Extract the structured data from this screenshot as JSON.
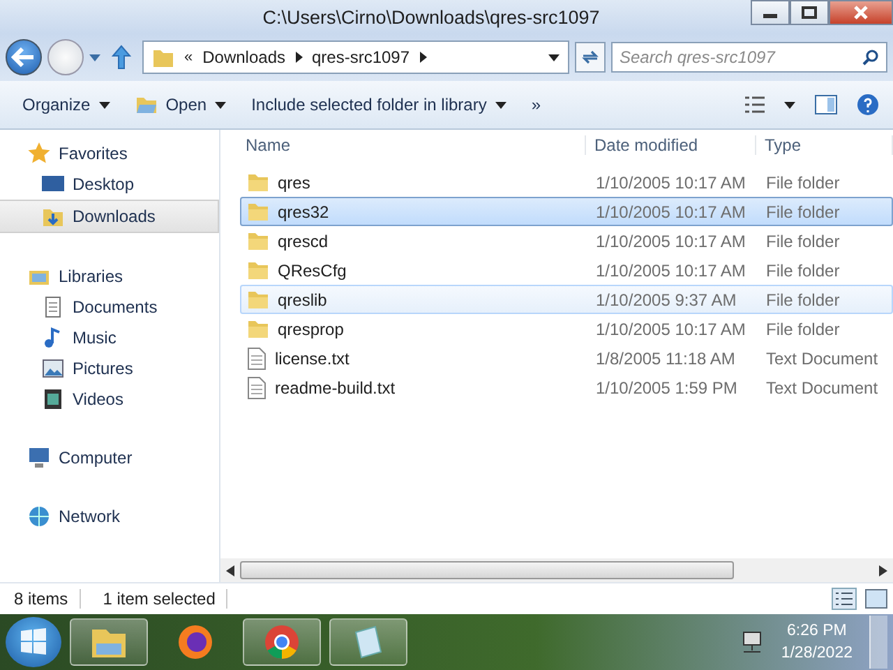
{
  "window": {
    "title": "C:\\Users\\Cirno\\Downloads\\qres-src1097"
  },
  "address": {
    "segments": [
      "Downloads",
      "qres-src1097"
    ],
    "overflow": "«"
  },
  "search": {
    "placeholder": "Search qres-src1097"
  },
  "toolbar": {
    "items": [
      "Organize",
      "Open",
      "Include selected folder in library"
    ],
    "more": "»"
  },
  "sidebar": {
    "groups": [
      {
        "label": "Favorites",
        "kind": "star",
        "items": [
          {
            "label": "Desktop",
            "kind": "desktop",
            "selected": false
          },
          {
            "label": "Downloads",
            "kind": "downloads",
            "selected": true
          }
        ]
      },
      {
        "label": "Libraries",
        "kind": "library",
        "items": [
          {
            "label": "Documents",
            "kind": "documents",
            "selected": false
          },
          {
            "label": "Music",
            "kind": "music",
            "selected": false
          },
          {
            "label": "Pictures",
            "kind": "pictures",
            "selected": false
          },
          {
            "label": "Videos",
            "kind": "videos",
            "selected": false
          }
        ]
      },
      {
        "label": "Computer",
        "kind": "computer"
      },
      {
        "label": "Network",
        "kind": "network"
      }
    ]
  },
  "table": {
    "columns": [
      "Name",
      "Date modified",
      "Type"
    ],
    "rows": [
      {
        "name": "qres",
        "date": "1/10/2005 10:17 AM",
        "type": "File folder",
        "kind": "folder",
        "selected": false,
        "hovered": false
      },
      {
        "name": "qres32",
        "date": "1/10/2005 10:17 AM",
        "type": "File folder",
        "kind": "folder",
        "selected": true,
        "hovered": false
      },
      {
        "name": "qrescd",
        "date": "1/10/2005 10:17 AM",
        "type": "File folder",
        "kind": "folder",
        "selected": false,
        "hovered": false
      },
      {
        "name": "QResCfg",
        "date": "1/10/2005 10:17 AM",
        "type": "File folder",
        "kind": "folder",
        "selected": false,
        "hovered": false
      },
      {
        "name": "qreslib",
        "date": "1/10/2005 9:37 AM",
        "type": "File folder",
        "kind": "folder",
        "selected": false,
        "hovered": true
      },
      {
        "name": "qresprop",
        "date": "1/10/2005 10:17 AM",
        "type": "File folder",
        "kind": "folder",
        "selected": false,
        "hovered": false
      },
      {
        "name": "license.txt",
        "date": "1/8/2005 11:18 AM",
        "type": "Text Document",
        "kind": "text",
        "selected": false,
        "hovered": false
      },
      {
        "name": "readme-build.txt",
        "date": "1/10/2005 1:59 PM",
        "type": "Text Document",
        "kind": "text",
        "selected": false,
        "hovered": false
      }
    ]
  },
  "status_bar": {
    "count": "8 items",
    "selection": "1 item selected"
  },
  "taskbar": {
    "apps": [
      {
        "kind": "explorer",
        "active": true
      },
      {
        "kind": "firefox",
        "active": false
      },
      {
        "kind": "chrome",
        "active": true
      },
      {
        "kind": "notepad",
        "active": true
      }
    ],
    "time": "6:26 PM",
    "date": "1/28/2022"
  }
}
